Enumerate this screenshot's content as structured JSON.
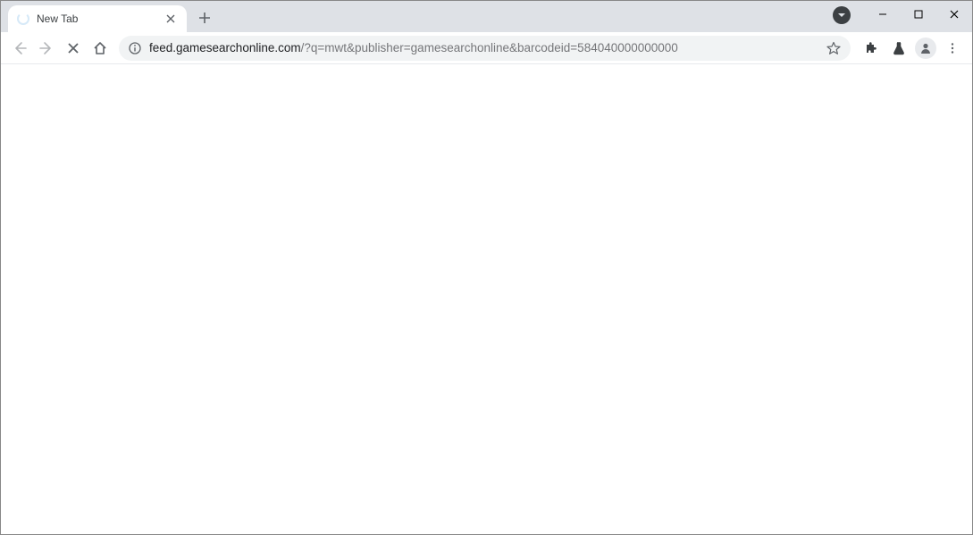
{
  "tab": {
    "title": "New Tab"
  },
  "url": {
    "domain": "feed.gamesearchonline.com",
    "path": "/?q=mwt&publisher=gamesearchonline&barcodeid=584040000000000"
  }
}
